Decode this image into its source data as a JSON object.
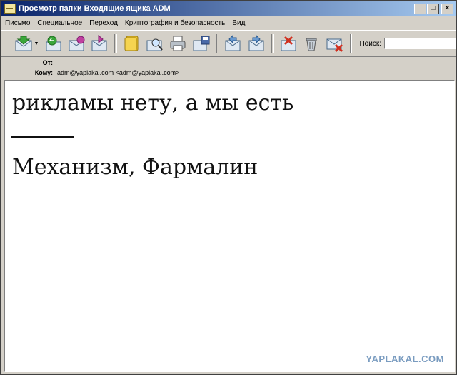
{
  "window": {
    "title": "Просмотр папки Входящие ящика ADM"
  },
  "controls": {
    "minimize": "_",
    "maximize": "□",
    "close": "×"
  },
  "menu": [
    {
      "prefix": "П",
      "rest": "исьмо"
    },
    {
      "prefix": "С",
      "rest": "пециальное"
    },
    {
      "prefix": "П",
      "rest": "ереход"
    },
    {
      "prefix": "К",
      "rest": "риптография и безопасность"
    },
    {
      "prefix": "В",
      "rest": "ид"
    }
  ],
  "toolbar": {
    "icons": [
      "get-mail-icon",
      "reply-icon",
      "reply-all-icon",
      "forward-icon",
      "address-book-icon",
      "find-icon",
      "print-icon",
      "save-icon",
      "previous-icon",
      "next-icon",
      "mark-junk-icon",
      "delete-icon",
      "delete-message-icon"
    ],
    "search_label": "Поиск:",
    "search_value": ""
  },
  "headers": {
    "from_label": "От:",
    "from_value": "",
    "to_label": "Кому:",
    "to_value": "adm@yaplakal.com <adm@yaplakal.com>"
  },
  "message": {
    "line1": "рикламы нету, а мы есть",
    "line2": "Механизм, Фармалин"
  },
  "watermark": "YAPLAKAL.COM",
  "colors": {
    "title_start": "#0a246a",
    "title_end": "#a6caf0",
    "chrome": "#d4d0c8",
    "watermark": "#7a9cc0"
  }
}
